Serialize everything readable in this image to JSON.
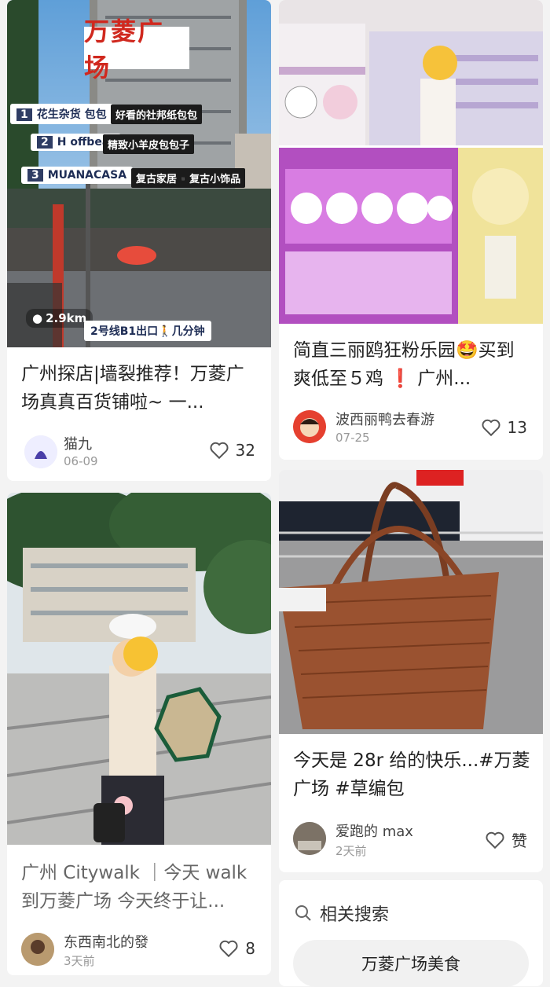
{
  "posts": [
    {
      "cover_title": "万菱广场",
      "cover_tags": [
        {
          "num": "1",
          "text": "花生杂货 包包",
          "note": "好看的社邦纸包包"
        },
        {
          "num": "2",
          "text": "H offbeat",
          "note": "精致小羊皮包包子"
        },
        {
          "num": "3",
          "text": "MUANACASA",
          "note": "复古家居▪️复古小饰品"
        }
      ],
      "cover_distance": "2.9km",
      "cover_route": "2号线B1出口🚶几分钟",
      "title": "广州探店|墙裂推荐！万菱广场真真百货铺啦~ 一...",
      "author": "猫九",
      "date": "06-09",
      "likes": "32"
    },
    {
      "title": "简直三丽鸥狂粉乐园🤩买到爽低至５鸡 ❗️ 广州...",
      "author": "波西丽鸭去春游",
      "date": "07-25",
      "likes": "13"
    },
    {
      "title": "今天是 28r 给的快乐...#万菱广场 #草编包",
      "author": "爱跑的 max",
      "date": "2天前",
      "likes": "赞"
    },
    {
      "title": "广州 Citywalk ｜今天 walk 到万菱广场 今天终于让...",
      "author": "东西南北的發",
      "date": "3天前",
      "likes": "8"
    }
  ],
  "related": {
    "label": "相关搜索",
    "first_suggestion": "万菱广场美食"
  }
}
